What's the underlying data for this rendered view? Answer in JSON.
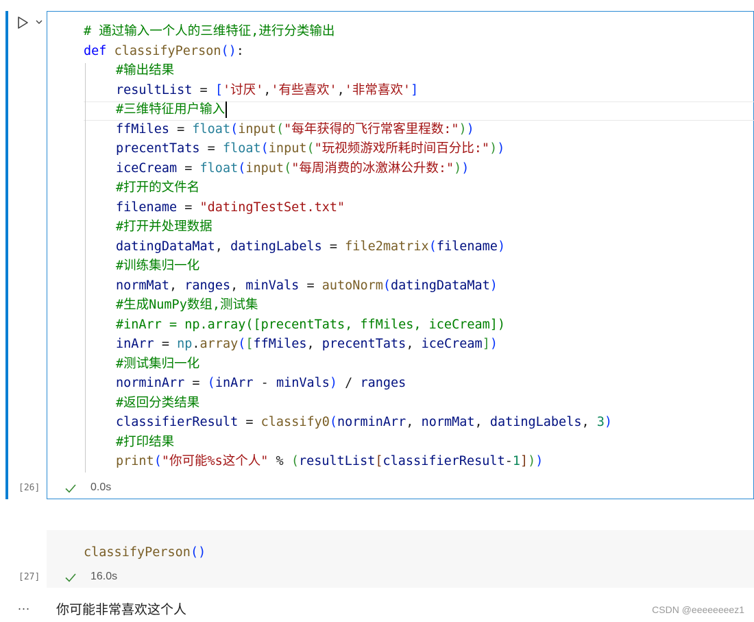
{
  "cell1": {
    "exec_count": "[26]",
    "status": "0.0s",
    "lines": [
      {
        "indent": 0,
        "tokens": [
          {
            "t": "# 通过输入一个人的三维特征,进行分类输出",
            "c": "cmt"
          }
        ]
      },
      {
        "indent": 0,
        "tokens": [
          {
            "t": "def ",
            "c": "kw"
          },
          {
            "t": "classifyPerson",
            "c": "fn"
          },
          {
            "t": "()",
            "c": "p1"
          },
          {
            "t": ":",
            "c": "op"
          }
        ]
      },
      {
        "indent": 1,
        "tokens": [
          {
            "t": "#输出结果",
            "c": "cmt"
          }
        ]
      },
      {
        "indent": 1,
        "tokens": [
          {
            "t": "resultList",
            "c": "var"
          },
          {
            "t": " = ",
            "c": "op"
          },
          {
            "t": "[",
            "c": "p1"
          },
          {
            "t": "'讨厌'",
            "c": "str"
          },
          {
            "t": ",",
            "c": "op"
          },
          {
            "t": "'有些喜欢'",
            "c": "str"
          },
          {
            "t": ",",
            "c": "op"
          },
          {
            "t": "'非常喜欢'",
            "c": "str"
          },
          {
            "t": "]",
            "c": "p1"
          }
        ]
      },
      {
        "indent": 1,
        "cursor": true,
        "tokens": [
          {
            "t": "#三维特征用户输入",
            "c": "cmt"
          }
        ]
      },
      {
        "indent": 1,
        "tokens": [
          {
            "t": "ffMiles",
            "c": "var"
          },
          {
            "t": " = ",
            "c": "op"
          },
          {
            "t": "float",
            "c": "bi"
          },
          {
            "t": "(",
            "c": "p1"
          },
          {
            "t": "input",
            "c": "fn"
          },
          {
            "t": "(",
            "c": "p2"
          },
          {
            "t": "\"每年获得的飞行常客里程数:\"",
            "c": "str"
          },
          {
            "t": ")",
            "c": "p2"
          },
          {
            "t": ")",
            "c": "p1"
          }
        ]
      },
      {
        "indent": 1,
        "tokens": [
          {
            "t": "precentTats",
            "c": "var"
          },
          {
            "t": " = ",
            "c": "op"
          },
          {
            "t": "float",
            "c": "bi"
          },
          {
            "t": "(",
            "c": "p1"
          },
          {
            "t": "input",
            "c": "fn"
          },
          {
            "t": "(",
            "c": "p2"
          },
          {
            "t": "\"玩视频游戏所耗时间百分比:\"",
            "c": "str"
          },
          {
            "t": ")",
            "c": "p2"
          },
          {
            "t": ")",
            "c": "p1"
          }
        ]
      },
      {
        "indent": 1,
        "tokens": [
          {
            "t": "iceCream",
            "c": "var"
          },
          {
            "t": " = ",
            "c": "op"
          },
          {
            "t": "float",
            "c": "bi"
          },
          {
            "t": "(",
            "c": "p1"
          },
          {
            "t": "input",
            "c": "fn"
          },
          {
            "t": "(",
            "c": "p2"
          },
          {
            "t": "\"每周消费的冰激淋公升数:\"",
            "c": "str"
          },
          {
            "t": ")",
            "c": "p2"
          },
          {
            "t": ")",
            "c": "p1"
          }
        ]
      },
      {
        "indent": 1,
        "tokens": [
          {
            "t": "#打开的文件名",
            "c": "cmt"
          }
        ]
      },
      {
        "indent": 1,
        "tokens": [
          {
            "t": "filename",
            "c": "var"
          },
          {
            "t": " = ",
            "c": "op"
          },
          {
            "t": "\"datingTestSet.txt\"",
            "c": "str"
          }
        ]
      },
      {
        "indent": 1,
        "tokens": [
          {
            "t": "#打开并处理数据",
            "c": "cmt"
          }
        ]
      },
      {
        "indent": 1,
        "tokens": [
          {
            "t": "datingDataMat",
            "c": "var"
          },
          {
            "t": ", ",
            "c": "op"
          },
          {
            "t": "datingLabels",
            "c": "var"
          },
          {
            "t": " = ",
            "c": "op"
          },
          {
            "t": "file2matrix",
            "c": "fn"
          },
          {
            "t": "(",
            "c": "p1"
          },
          {
            "t": "filename",
            "c": "var"
          },
          {
            "t": ")",
            "c": "p1"
          }
        ]
      },
      {
        "indent": 1,
        "tokens": [
          {
            "t": "#训练集归一化",
            "c": "cmt"
          }
        ]
      },
      {
        "indent": 1,
        "tokens": [
          {
            "t": "normMat",
            "c": "var"
          },
          {
            "t": ", ",
            "c": "op"
          },
          {
            "t": "ranges",
            "c": "var"
          },
          {
            "t": ", ",
            "c": "op"
          },
          {
            "t": "minVals",
            "c": "var"
          },
          {
            "t": " = ",
            "c": "op"
          },
          {
            "t": "autoNorm",
            "c": "fn"
          },
          {
            "t": "(",
            "c": "p1"
          },
          {
            "t": "datingDataMat",
            "c": "var"
          },
          {
            "t": ")",
            "c": "p1"
          }
        ]
      },
      {
        "indent": 1,
        "tokens": [
          {
            "t": "#生成NumPy数组,测试集",
            "c": "cmt"
          }
        ]
      },
      {
        "indent": 1,
        "tokens": [
          {
            "t": "#inArr = np.array([precentTats, ffMiles, iceCream])",
            "c": "cmt"
          }
        ]
      },
      {
        "indent": 1,
        "tokens": [
          {
            "t": "inArr",
            "c": "var"
          },
          {
            "t": " = ",
            "c": "op"
          },
          {
            "t": "np",
            "c": "bi"
          },
          {
            "t": ".",
            "c": "op"
          },
          {
            "t": "array",
            "c": "fn"
          },
          {
            "t": "(",
            "c": "p1"
          },
          {
            "t": "[",
            "c": "p2"
          },
          {
            "t": "ffMiles",
            "c": "var"
          },
          {
            "t": ", ",
            "c": "op"
          },
          {
            "t": "precentTats",
            "c": "var"
          },
          {
            "t": ", ",
            "c": "op"
          },
          {
            "t": "iceCream",
            "c": "var"
          },
          {
            "t": "]",
            "c": "p2"
          },
          {
            "t": ")",
            "c": "p1"
          }
        ]
      },
      {
        "indent": 1,
        "tokens": [
          {
            "t": "#测试集归一化",
            "c": "cmt"
          }
        ]
      },
      {
        "indent": 1,
        "tokens": [
          {
            "t": "norminArr",
            "c": "var"
          },
          {
            "t": " = ",
            "c": "op"
          },
          {
            "t": "(",
            "c": "p1"
          },
          {
            "t": "inArr",
            "c": "var"
          },
          {
            "t": " - ",
            "c": "op"
          },
          {
            "t": "minVals",
            "c": "var"
          },
          {
            "t": ")",
            "c": "p1"
          },
          {
            "t": " / ",
            "c": "op"
          },
          {
            "t": "ranges",
            "c": "var"
          }
        ]
      },
      {
        "indent": 1,
        "tokens": [
          {
            "t": "#返回分类结果",
            "c": "cmt"
          }
        ]
      },
      {
        "indent": 1,
        "tokens": [
          {
            "t": "classifierResult",
            "c": "var"
          },
          {
            "t": " = ",
            "c": "op"
          },
          {
            "t": "classify0",
            "c": "fn"
          },
          {
            "t": "(",
            "c": "p1"
          },
          {
            "t": "norminArr",
            "c": "var"
          },
          {
            "t": ", ",
            "c": "op"
          },
          {
            "t": "normMat",
            "c": "var"
          },
          {
            "t": ", ",
            "c": "op"
          },
          {
            "t": "datingLabels",
            "c": "var"
          },
          {
            "t": ", ",
            "c": "op"
          },
          {
            "t": "3",
            "c": "num"
          },
          {
            "t": ")",
            "c": "p1"
          }
        ]
      },
      {
        "indent": 1,
        "tokens": [
          {
            "t": "#打印结果",
            "c": "cmt"
          }
        ]
      },
      {
        "indent": 1,
        "tokens": [
          {
            "t": "print",
            "c": "fn"
          },
          {
            "t": "(",
            "c": "p1"
          },
          {
            "t": "\"你可能%s这个人\"",
            "c": "str"
          },
          {
            "t": " % ",
            "c": "op"
          },
          {
            "t": "(",
            "c": "p2"
          },
          {
            "t": "resultList",
            "c": "var"
          },
          {
            "t": "[",
            "c": "p3"
          },
          {
            "t": "classifierResult",
            "c": "var"
          },
          {
            "t": "-",
            "c": "op"
          },
          {
            "t": "1",
            "c": "num"
          },
          {
            "t": "]",
            "c": "p3"
          },
          {
            "t": ")",
            "c": "p2"
          },
          {
            "t": ")",
            "c": "p1"
          }
        ]
      }
    ]
  },
  "cell2": {
    "exec_count": "[27]",
    "status": "16.0s",
    "code": {
      "name": "classifyPerson",
      "parens": "()"
    }
  },
  "output": {
    "more_icon": "...",
    "text": "你可能非常喜欢这个人"
  },
  "watermark": "CSDN @eeeeeeeez1",
  "icons": {
    "run": "play-icon",
    "more": "chevron-down-icon",
    "success": "check-icon"
  },
  "colors": {
    "focus": "#0a7fd4",
    "success": "#388a34"
  }
}
